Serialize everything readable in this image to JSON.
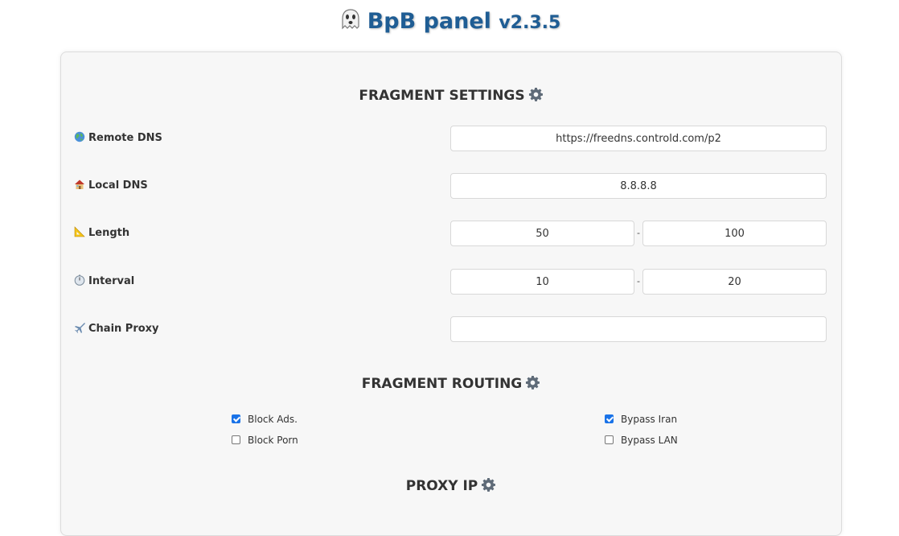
{
  "header": {
    "title": "BpB panel",
    "version": "v2.3.5",
    "icon": "ghost-icon"
  },
  "fragment_settings": {
    "title": "FRAGMENT SETTINGS",
    "icon": "gear-icon",
    "fields": {
      "remote_dns": {
        "label": "Remote DNS",
        "icon": "globe-icon",
        "value": "https://freedns.controld.com/p2"
      },
      "local_dns": {
        "label": "Local DNS",
        "icon": "house-icon",
        "value": "8.8.8.8"
      },
      "length": {
        "label": "Length",
        "icon": "triangular-ruler-icon",
        "min": "50",
        "max": "100",
        "separator": "-"
      },
      "interval": {
        "label": "Interval",
        "icon": "stopwatch-icon",
        "min": "10",
        "max": "20",
        "separator": "-"
      },
      "chain_proxy": {
        "label": "Chain Proxy",
        "icon": "airplane-icon",
        "value": ""
      }
    }
  },
  "fragment_routing": {
    "title": "FRAGMENT ROUTING",
    "icon": "gear-icon",
    "options": {
      "block_ads": {
        "label": "Block Ads.",
        "checked": true
      },
      "block_porn": {
        "label": "Block Porn",
        "checked": false
      },
      "bypass_iran": {
        "label": "Bypass Iran",
        "checked": true
      },
      "bypass_lan": {
        "label": "Bypass LAN",
        "checked": false
      }
    }
  },
  "proxy_ip": {
    "title": "PROXY IP",
    "icon": "gear-icon"
  },
  "colors": {
    "title": "#1f5d94",
    "checkbox_accent": "#1a73e8",
    "card_bg": "#f7f7f7"
  }
}
